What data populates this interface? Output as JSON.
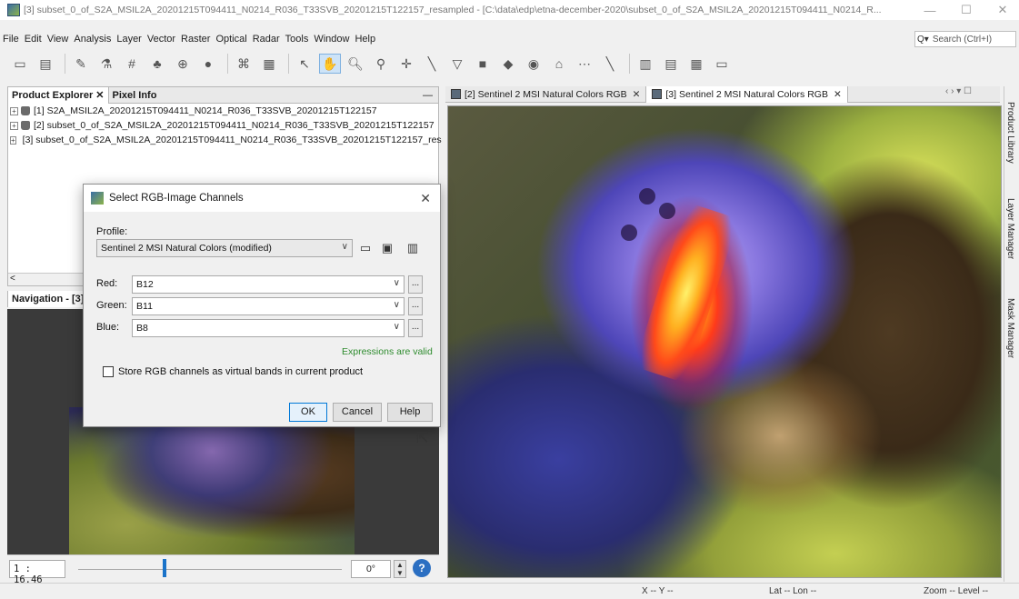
{
  "window": {
    "title": "[3] subset_0_of_S2A_MSIL2A_20201215T094411_N0214_R036_T33SVB_20201215T122157_resampled - [C:\\data\\edp\\etna-december-2020\\subset_0_of_S2A_MSIL2A_20201215T094411_N0214_R...",
    "minimize": "—",
    "maximize": "☐",
    "close": "✕"
  },
  "menu": [
    "File",
    "Edit",
    "View",
    "Analysis",
    "Layer",
    "Vector",
    "Raster",
    "Optical",
    "Radar",
    "Tools",
    "Window",
    "Help"
  ],
  "search": {
    "placeholder": "Search (Ctrl+I)"
  },
  "toolbar_icons": [
    "open-product-icon",
    "save-product-icon",
    "band-maths-icon",
    "wizard-icon",
    "statistics-icon",
    "pin-icon",
    "gcp-icon",
    "layer-icon",
    "graph-builder-icon",
    "batch-icon",
    "select-tool-icon",
    "pan-tool-icon",
    "zoom-tool-icon",
    "pin-placing-icon",
    "gcp-placing-icon",
    "draw-line-icon",
    "draw-polygon-icon",
    "draw-rectangle-icon",
    "draw-ellipse-icon",
    "magic-wand-icon",
    "range-finder-icon",
    "ruler-icon",
    "tile-horizontal-icon",
    "tile-vertical-icon",
    "tile-grid-icon",
    "tile-single-icon"
  ],
  "product_explorer": {
    "tab1": "Product Explorer",
    "tab2": "Pixel Info",
    "items": [
      "[1] S2A_MSIL2A_20201215T094411_N0214_R036_T33SVB_20201215T122157",
      "[2] subset_0_of_S2A_MSIL2A_20201215T094411_N0214_R036_T33SVB_20201215T122157",
      "[3] subset_0_of_S2A_MSIL2A_20201215T094411_N0214_R036_T33SVB_20201215T122157_res"
    ]
  },
  "navigation": {
    "title": "Navigation - [3]...",
    "zoom": "1 : 16.46",
    "zoom_fraction": 0.32,
    "rotation": "0°",
    "help": "?"
  },
  "view_tabs": [
    {
      "label": "[2] Sentinel 2 MSI Natural Colors RGB",
      "active": false
    },
    {
      "label": "[3] Sentinel 2 MSI Natural Colors RGB",
      "active": true
    }
  ],
  "view_controls": "‹ › ▾ ☐",
  "side_tools": [
    "Product Library",
    "Layer Manager",
    "Mask Manager"
  ],
  "status": {
    "x": "X -- Y --",
    "lat": "Lat -- Lon --",
    "zoom": "Zoom -- Level --"
  },
  "dialog": {
    "title": "Select RGB-Image Channels",
    "profile_label": "Profile:",
    "profile_value": "Sentinel 2 MSI Natural Colors (modified)",
    "red_label": "Red:",
    "red_value": "B12",
    "green_label": "Green:",
    "green_value": "B11",
    "blue_label": "Blue:",
    "blue_value": "B8",
    "valid_text": "Expressions are valid",
    "checkbox_label": "Store RGB channels as virtual bands in current product",
    "ok": "OK",
    "cancel": "Cancel",
    "help": "Help",
    "dots": "..."
  },
  "colors": {
    "accent": "#0078d7",
    "valid": "#2e8b2e"
  }
}
